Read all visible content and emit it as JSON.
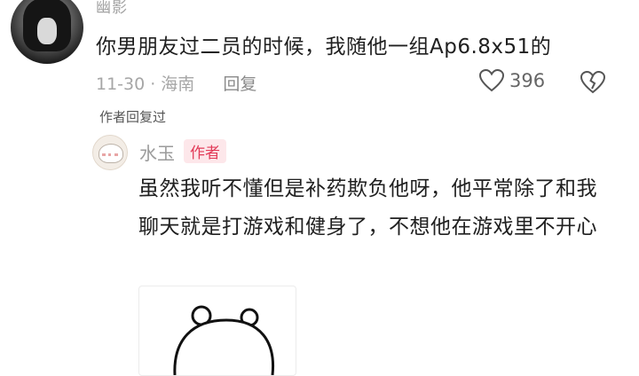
{
  "comment": {
    "username": "幽影",
    "text": "你男朋友过二员的时候，我随他一组Ap6.8x51的",
    "date": "11-30",
    "separator": "·",
    "location": "海南",
    "reply_label": "回复",
    "like_count": "396",
    "icons": [
      "heart-icon",
      "broken-heart-icon"
    ]
  },
  "thread": {
    "author_replied_label": "作者回复过"
  },
  "reply": {
    "username": "水玉",
    "badge": "作者",
    "text": "虽然我听不懂但是补药欺负他呀，他平常除了和我聊天就是打游戏和健身了，不想他在游戏里不开心",
    "badge_color": "#e23b58"
  }
}
